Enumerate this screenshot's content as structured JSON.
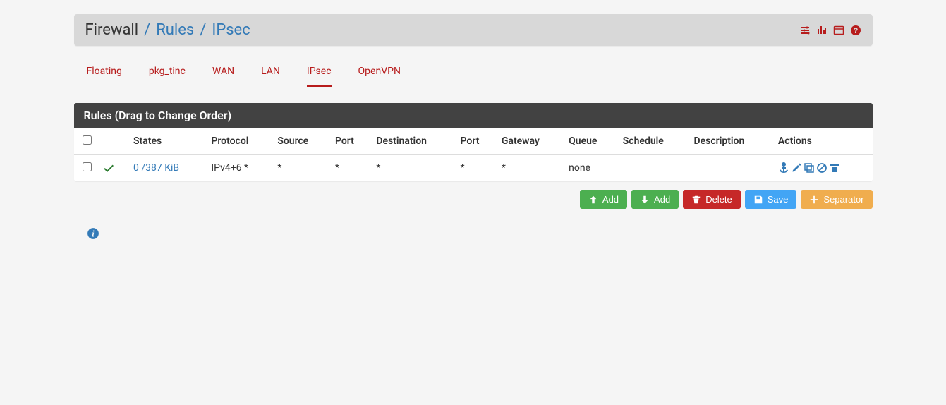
{
  "breadcrumb": {
    "root": "Firewall",
    "level1": "Rules",
    "level2": "IPsec"
  },
  "tabs": [
    {
      "label": "Floating",
      "active": false
    },
    {
      "label": "pkg_tinc",
      "active": false
    },
    {
      "label": "WAN",
      "active": false
    },
    {
      "label": "LAN",
      "active": false
    },
    {
      "label": "IPsec",
      "active": true
    },
    {
      "label": "OpenVPN",
      "active": false
    }
  ],
  "panel": {
    "title": "Rules (Drag to Change Order)"
  },
  "columns": {
    "c0": "",
    "c1": "",
    "c2": "States",
    "c3": "Protocol",
    "c4": "Source",
    "c5": "Port",
    "c6": "Destination",
    "c7": "Port",
    "c8": "Gateway",
    "c9": "Queue",
    "c10": "Schedule",
    "c11": "Description",
    "c12": "Actions"
  },
  "row": {
    "states": "0 /387 KiB",
    "protocol": "IPv4+6 *",
    "source": "*",
    "port1": "*",
    "destination": "*",
    "port2": "*",
    "gateway": "*",
    "queue": "none",
    "schedule": "",
    "description": ""
  },
  "buttons": {
    "add1": "Add",
    "add2": "Add",
    "delete": "Delete",
    "save": "Save",
    "separator": "Separator"
  }
}
